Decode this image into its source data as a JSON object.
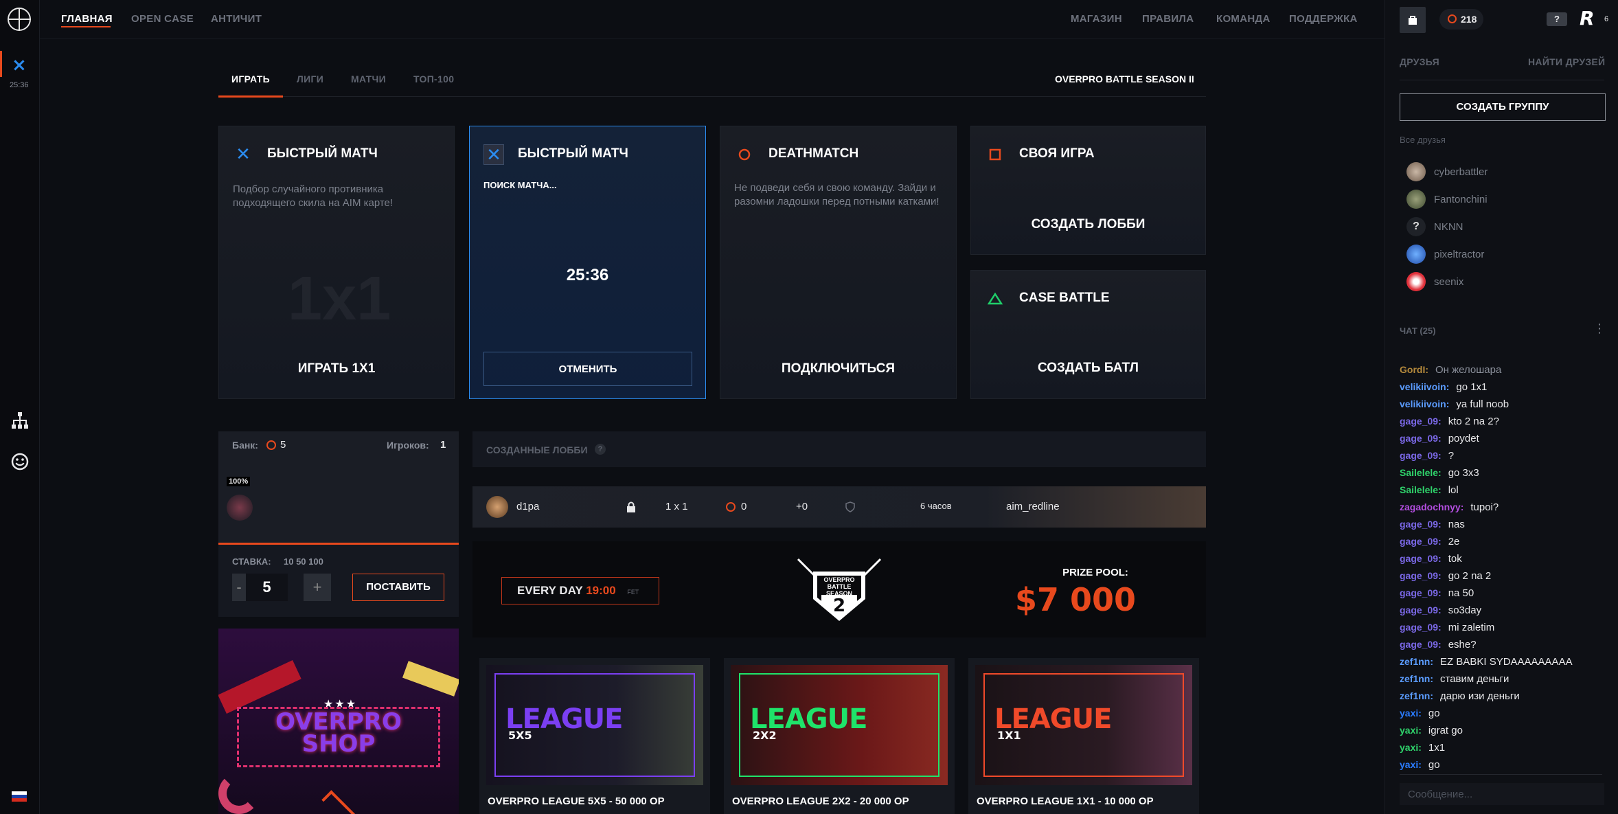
{
  "rail": {
    "timer": "25:36",
    "timer_icon": "×"
  },
  "nav": {
    "left": [
      "ГЛАВНАЯ",
      "OPEN CASE",
      "АНТИЧИТ"
    ],
    "right": [
      "МАГАЗИН",
      "ПРАВИЛА",
      "КОМАНДА",
      "ПОДДЕРЖКА"
    ]
  },
  "user": {
    "balance": "218",
    "help": "?",
    "badge": "6",
    "avatar_letter": "R"
  },
  "tabs": [
    "ИГРАТЬ",
    "ЛИГИ",
    "МАТЧИ",
    "ТОП-100"
  ],
  "season_title": "OVERPRO BATTLE SEASON II",
  "cards": {
    "quick1": {
      "title": "БЫСТРЫЙ МАТЧ",
      "desc": "Подбор случайного противника подходящего скила на AIM карте!",
      "action": "ИГРАТЬ 1X1",
      "watermark": "1x1"
    },
    "quick2": {
      "title": "БЫСТРЫЙ МАТЧ",
      "status": "ПОИСК МАТЧА...",
      "timer": "25:36",
      "action": "ОТМЕНИТЬ"
    },
    "deathmatch": {
      "title": "DEATHMATCH",
      "desc": "Не подведи себя и свою команду. Зайди и разомни ладошки перед потными катками!",
      "action": "ПОДКЛЮЧИТЬСЯ"
    },
    "custom": {
      "title": "СВОЯ ИГРА",
      "action": "СОЗДАТЬ ЛОББИ"
    },
    "casebattle": {
      "title": "CASE BATTLE",
      "action": "СОЗДАТЬ БАТЛ"
    }
  },
  "bank": {
    "label": "Банк:",
    "value": "5",
    "players_label": "Игроков:",
    "players": "1",
    "percent": "100%",
    "stake_label": "СТАВКА:",
    "stake_options": "10 50 100",
    "minus": "-",
    "stake": "5",
    "plus": "+",
    "place": "ПОСТАВИТЬ"
  },
  "shop": {
    "title1": "OVERPRO",
    "title2": "SHOP"
  },
  "lobbies": {
    "title": "СОЗДАННЫЕ ЛОББИ",
    "row": {
      "name": "d1pa",
      "mode": "1 x 1",
      "bet": "0",
      "extra": "+0",
      "time": "6 часов",
      "map": "aim_redline"
    }
  },
  "banner": {
    "every_day": "EVERY DAY",
    "time": "19:00",
    "tz": "FET",
    "prize_label": "PRIZE POOL:",
    "prize": "$7 000",
    "logo_top": "OVERPRO",
    "logo_mid": "BATTLE",
    "logo_season": "SEASON",
    "logo_num": "2"
  },
  "leagues": [
    {
      "word": "LEAGUE",
      "fmt": "5X5",
      "caption": "OVERPRO LEAGUE 5X5 - 50 000 OP",
      "color": "#7b3ff2"
    },
    {
      "word": "LEAGUE",
      "fmt": "2X2",
      "caption": "OVERPRO LEAGUE 2X2 - 20 000 OP",
      "color": "#1fe36a"
    },
    {
      "word": "LEAGUE",
      "fmt": "1X1",
      "caption": "OVERPRO LEAGUE 1X1 - 10 000 OP",
      "color": "#f04a2a"
    }
  ],
  "friends": {
    "tab": "ДРУЗЬЯ",
    "find": "НАЙТИ ДРУЗЕЙ",
    "create_group": "СОЗДАТЬ ГРУППУ",
    "all": "Все друзья",
    "list": [
      "cyberbattler",
      "Fantonchini",
      "NKNN",
      "pixeltractor",
      "seenix"
    ]
  },
  "chat": {
    "title": "ЧАТ (25)",
    "placeholder": "Сообщение...",
    "messages": [
      {
        "user": "GordI:",
        "text": "Он желошара",
        "color": "#b58a3c"
      },
      {
        "user": "velikiivoin:",
        "text": "go 1x1",
        "color": "#5b9cff"
      },
      {
        "user": "velikiivoin:",
        "text": "ya full noob",
        "color": "#5b9cff"
      },
      {
        "user": "gage_09:",
        "text": "kto 2 na 2?",
        "color": "#7a68e6"
      },
      {
        "user": "gage_09:",
        "text": "poydet",
        "color": "#7a68e6"
      },
      {
        "user": "gage_09:",
        "text": "?",
        "color": "#7a68e6"
      },
      {
        "user": "Sailelele:",
        "text": "go 3x3",
        "color": "#2fd36b"
      },
      {
        "user": "Sailelele:",
        "text": "lol",
        "color": "#2fd36b"
      },
      {
        "user": "zagadochnyy:",
        "text": "tupoi?",
        "color": "#b34ee0"
      },
      {
        "user": "gage_09:",
        "text": "nas",
        "color": "#7a68e6"
      },
      {
        "user": "gage_09:",
        "text": "2e",
        "color": "#7a68e6"
      },
      {
        "user": "gage_09:",
        "text": "tok",
        "color": "#7a68e6"
      },
      {
        "user": "gage_09:",
        "text": "go 2 na 2",
        "color": "#7a68e6"
      },
      {
        "user": "gage_09:",
        "text": "na 50",
        "color": "#7a68e6"
      },
      {
        "user": "gage_09:",
        "text": "so3day",
        "color": "#7a68e6"
      },
      {
        "user": "gage_09:",
        "text": "mi zaletim",
        "color": "#7a68e6"
      },
      {
        "user": "gage_09:",
        "text": "eshe?",
        "color": "#7a68e6"
      },
      {
        "user": "zef1nn:",
        "text": "EZ BABKI SYDAAAAAAAAA",
        "color": "#5b9cff"
      },
      {
        "user": "zef1nn:",
        "text": "ставим деньги",
        "color": "#5b9cff"
      },
      {
        "user": "zef1nn:",
        "text": "дарю изи деньги",
        "color": "#5b9cff"
      },
      {
        "user": "yaxi:",
        "text": "go",
        "color": "#2b7cff"
      },
      {
        "user": "yaxi:",
        "text": "igrat go",
        "color": "#2fd36b"
      },
      {
        "user": "yaxi:",
        "text": "1x1",
        "color": "#2fd36b"
      },
      {
        "user": "yaxi:",
        "text": "go",
        "color": "#2b7cff"
      }
    ]
  }
}
